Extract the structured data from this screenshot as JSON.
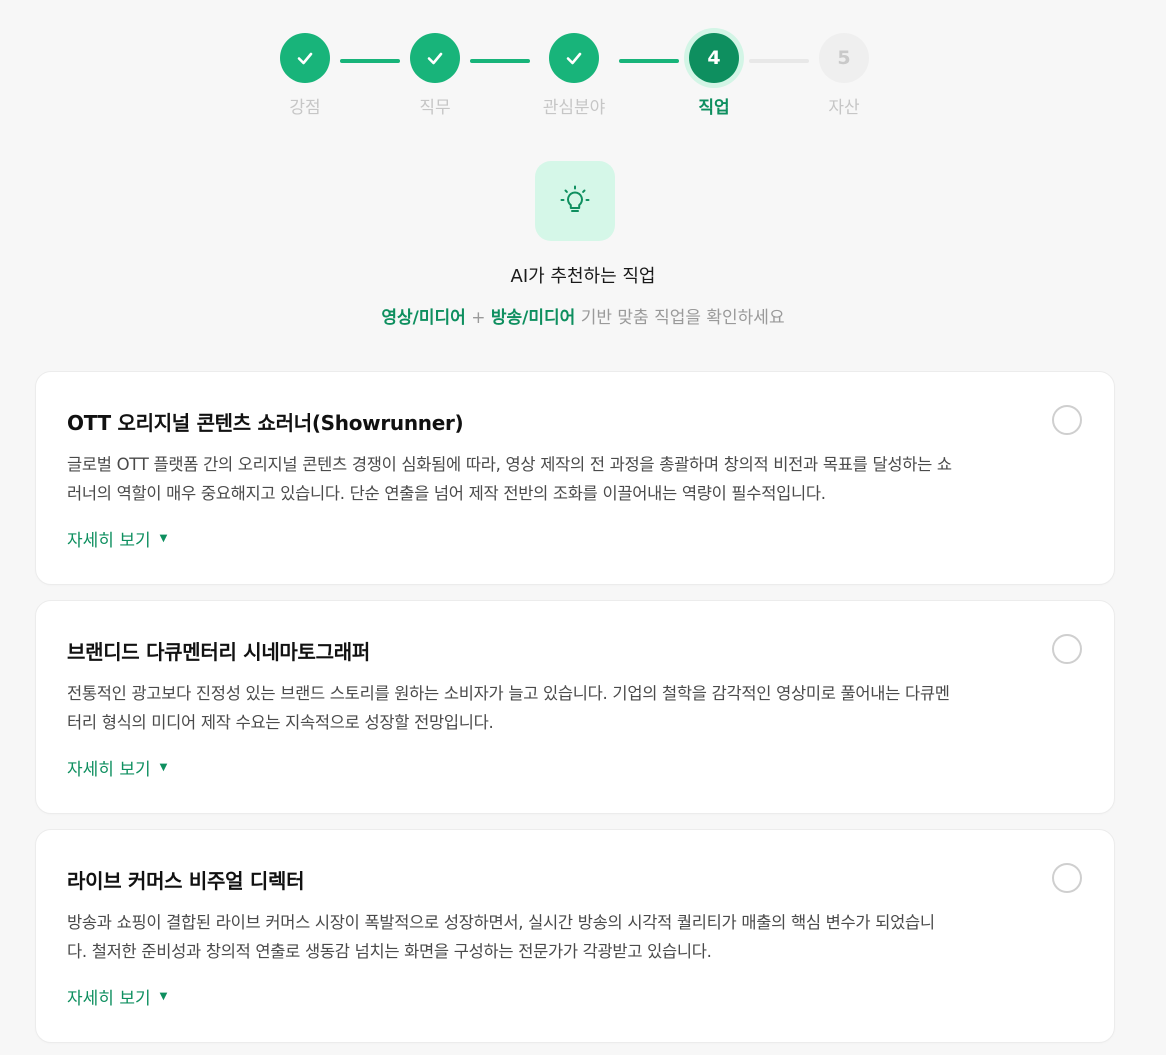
{
  "stepper": {
    "steps": [
      {
        "label": "강점",
        "state": "done"
      },
      {
        "label": "직무",
        "state": "done"
      },
      {
        "label": "관심분야",
        "state": "done"
      },
      {
        "label": "직업",
        "state": "active",
        "number": "4"
      },
      {
        "label": "자산",
        "state": "todo",
        "number": "5"
      }
    ]
  },
  "hero": {
    "icon": "lightbulb-icon",
    "title": "AI가 추천하는 직업",
    "subtitle_highlight_1": "영상/미디어",
    "subtitle_plus": " + ",
    "subtitle_highlight_2": "방송/미디어",
    "subtitle_rest": " 기반 맞춤 직업을 확인하세요"
  },
  "colors": {
    "accent": "#18b47a",
    "accent_dark": "#0e8f5f",
    "accent_soft": "#d5f7e8"
  },
  "cards": [
    {
      "title": "OTT 오리지널 콘텐츠 쇼러너(Showrunner)",
      "desc_1": "글로벌 OTT 플랫폼 간의 오리지널 콘텐츠 경쟁이 심화됨에 따라, 영상 제작의 전 과정을 총괄하며 창의적 비전과 목표를 달성하는 쇼",
      "desc_2": "러너의 역할이 매우 중요해지고 있습니다. 단순 연출을 넘어 제작 전반의 조화를 이끌어내는 역량이 필수적입니다.",
      "more": "자세히 보기",
      "selected": false
    },
    {
      "title": "브랜디드 다큐멘터리 시네마토그래퍼",
      "desc_1": "전통적인 광고보다 진정성 있는 브랜드 스토리를 원하는 소비자가 늘고 있습니다. 기업의 철학을 감각적인 영상미로 풀어내는 다큐멘",
      "desc_2": "터리 형식의 미디어 제작 수요는 지속적으로 성장할 전망입니다.",
      "more": "자세히 보기",
      "selected": false
    },
    {
      "title": "라이브 커머스 비주얼 디렉터",
      "desc_1": "방송과 쇼핑이 결합된 라이브 커머스 시장이 폭발적으로 성장하면서, 실시간 방송의 시각적 퀄리티가 매출의 핵심 변수가 되었습니",
      "desc_2": "다. 철저한 준비성과 창의적 연출로 생동감 넘치는 화면을 구성하는 전문가가 각광받고 있습니다.",
      "more": "자세히 보기",
      "selected": false
    }
  ]
}
